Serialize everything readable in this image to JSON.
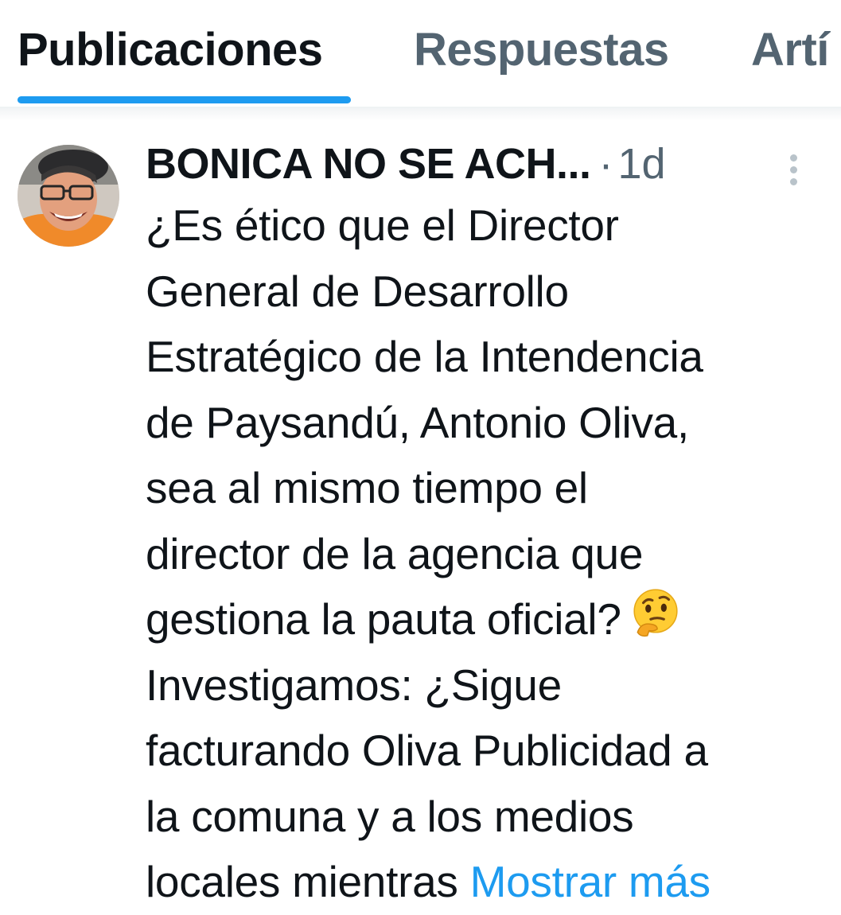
{
  "tabs": [
    {
      "label": "Publicaciones",
      "active": true
    },
    {
      "label": "Respuestas",
      "active": false
    },
    {
      "label": "Artí",
      "active": false
    }
  ],
  "colors": {
    "accent": "#1d9bf0",
    "text_primary": "#0f1419",
    "text_secondary": "#536471",
    "divider": "#eff3f4"
  },
  "post": {
    "author_name": "BONICA NO SE ACH...",
    "separator": "·",
    "time": "1d",
    "more_icon": "more-vertical-icon",
    "text_lines": [
      "¿Es ético que el Director",
      "General de Desarrollo",
      "Estratégico de la Intendencia",
      "de Paysandú, Antonio Oliva,",
      "sea al mismo tiempo el",
      "director de la agencia que",
      "gestiona la pauta oficial?",
      "Investigamos: ¿Sigue",
      "facturando Oliva Publicidad a",
      "la comuna y a los medios",
      "locales mientras"
    ],
    "emoji": "thinking-face-emoji",
    "show_more_label": "Mostrar más"
  }
}
